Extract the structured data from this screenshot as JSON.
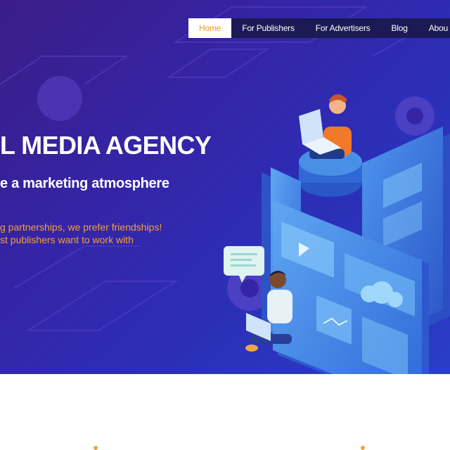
{
  "nav": {
    "items": [
      {
        "label": "Home",
        "active": true
      },
      {
        "label": "For Publishers",
        "active": false
      },
      {
        "label": "For Advertisers",
        "active": false
      },
      {
        "label": "Blog",
        "active": false
      },
      {
        "label": "Abou",
        "active": false
      }
    ]
  },
  "hero": {
    "headline": "L MEDIA AGENCY",
    "subheadline": "e a marketing atmosphere",
    "tagline_1": "g partnerships, we prefer friendships!",
    "tagline_2": "st publishers want to work with"
  },
  "colors": {
    "hero_background": "#3524a6",
    "nav_background": "#1b1a55",
    "accent_orange": "#f39a1a",
    "panel_blue": "#4a8fe6"
  },
  "icons": [
    "gear-icon",
    "chat-bubble-icon",
    "cloud-icon",
    "play-icon",
    "laptop-icon"
  ]
}
